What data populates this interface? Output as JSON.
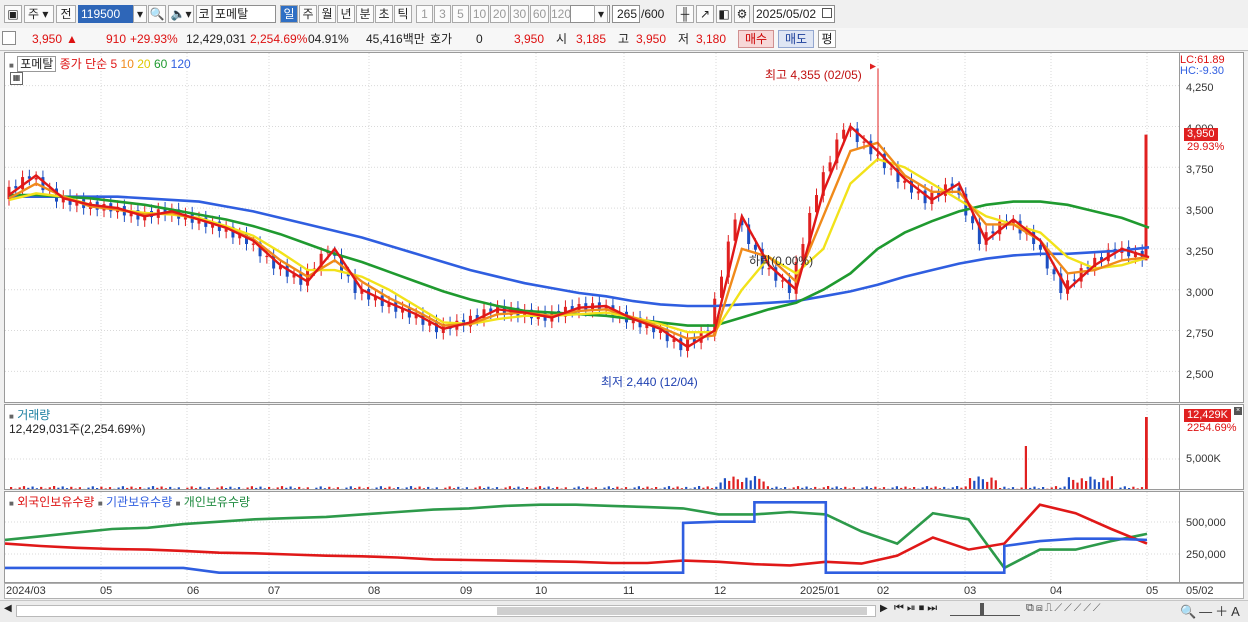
{
  "toolbar": {
    "market_label": "주",
    "prev_label": "전",
    "code_value": "119500",
    "market_tag": "코",
    "stock_name": "포메탈",
    "periods": [
      "일",
      "주",
      "월",
      "년",
      "분",
      "초",
      "틱"
    ],
    "active_period": "일",
    "intervals": [
      "1",
      "3",
      "5",
      "10",
      "20",
      "30",
      "60",
      "120"
    ],
    "count_value": "265",
    "count_total": "/600",
    "date_value": "2025/05/02"
  },
  "quote": {
    "price": "3,950",
    "change": "910",
    "change_pct": "+29.93%",
    "volume": "12,429,031",
    "volume_pct": "2,254.69%",
    "turnover_pct": "04.91%",
    "amount": "45,416백만",
    "hoga_label": "호가",
    "hoga_value": "0",
    "hoga_price": "3,950",
    "open_label": "시",
    "open_value": "3,185",
    "high_label": "고",
    "high_value": "3,950",
    "low_label": "저",
    "low_value": "3,180",
    "buy_label": "매수",
    "sell_label": "매도",
    "avg_label": "평"
  },
  "price_panel": {
    "name": "포메탈",
    "ma_title": "종가 단순",
    "ma_periods": [
      "5",
      "10",
      "20",
      "60",
      "120"
    ],
    "lc_label": "LC:61.89",
    "hc_label": "HC:-9.30",
    "high_annotation": "최고 4,355 (02/05)",
    "low_annotation": "최저 2,440 (12/04)",
    "mid_annotation": "하락(0.00%)",
    "current_badge": "3,950",
    "current_pct": "29.93%",
    "y_ticks": [
      "4,250",
      "4,000",
      "3,750",
      "3,500",
      "3,250",
      "3,000",
      "2,750",
      "2,500"
    ]
  },
  "volume_panel": {
    "title": "거래량",
    "value_text": "12,429,031주(2,254.69%)",
    "badge": "12,429K",
    "badge_pct": "2254.69%",
    "y_tick": "5,000K"
  },
  "holdings_panel": {
    "series_labels": [
      "외국인보유수량",
      "기관보유수량",
      "개인보유수량"
    ],
    "y_ticks": [
      "500,000",
      "250,000"
    ]
  },
  "x_axis": [
    "2024/03",
    "05",
    "06",
    "07",
    "08",
    "09",
    "10",
    "11",
    "12",
    "2025/01",
    "02",
    "03",
    "04",
    "05",
    "05/02"
  ],
  "colors": {
    "up": "#e02020",
    "down": "#1d4fc2",
    "ma5": "#e01818",
    "ma10": "#f08a1a",
    "ma20": "#f2e21a",
    "ma60": "#1f9a2f",
    "ma120": "#2f5ee0",
    "foreign": "#e01818",
    "institution": "#2f5ee0",
    "individual": "#2d9a4a"
  },
  "chart_data": {
    "type": "line",
    "title": "",
    "series": [
      {
        "name": "5",
        "values": [
          3580,
          3700,
          3560,
          3520,
          3500,
          3450,
          3480,
          3430,
          3380,
          3300,
          3150,
          3050,
          3250,
          3000,
          2920,
          2850,
          2760,
          2800,
          2880,
          2860,
          2830,
          2890,
          2900,
          2820,
          2760,
          2650,
          2750,
          3450,
          3150,
          3000,
          3600,
          4000,
          3850,
          3680,
          3550,
          3650,
          3300,
          3430,
          3300,
          3000,
          3150,
          3250,
          3200
        ]
      },
      {
        "name": "10",
        "values": [
          3560,
          3650,
          3570,
          3510,
          3490,
          3460,
          3470,
          3430,
          3380,
          3310,
          3180,
          3080,
          3180,
          3050,
          2950,
          2870,
          2780,
          2790,
          2850,
          2860,
          2840,
          2870,
          2880,
          2830,
          2770,
          2700,
          2720,
          3250,
          3200,
          3050,
          3450,
          3850,
          3900,
          3700,
          3600,
          3600,
          3400,
          3400,
          3300,
          3100,
          3120,
          3180,
          3200
        ]
      },
      {
        "name": "20",
        "values": [
          3550,
          3590,
          3570,
          3520,
          3490,
          3470,
          3460,
          3440,
          3390,
          3330,
          3230,
          3120,
          3120,
          3080,
          3000,
          2900,
          2800,
          2790,
          2820,
          2840,
          2840,
          2850,
          2860,
          2830,
          2790,
          2740,
          2740,
          3000,
          3200,
          3100,
          3250,
          3650,
          3800,
          3750,
          3650,
          3550,
          3450,
          3400,
          3350,
          3200,
          3130,
          3150,
          3200
        ]
      },
      {
        "name": "60",
        "values": [
          3580,
          3580,
          3570,
          3560,
          3540,
          3520,
          3490,
          3460,
          3430,
          3390,
          3340,
          3280,
          3220,
          3170,
          3110,
          3050,
          2990,
          2940,
          2900,
          2870,
          2860,
          2850,
          2840,
          2820,
          2800,
          2780,
          2780,
          2830,
          2880,
          2920,
          3000,
          3100,
          3250,
          3350,
          3420,
          3480,
          3520,
          3540,
          3540,
          3520,
          3480,
          3440,
          3380
        ]
      },
      {
        "name": "120",
        "values": [
          3570,
          3570,
          3570,
          3570,
          3570,
          3560,
          3550,
          3540,
          3510,
          3480,
          3440,
          3400,
          3360,
          3320,
          3270,
          3220,
          3170,
          3120,
          3080,
          3040,
          3010,
          2980,
          2960,
          2930,
          2910,
          2900,
          2900,
          2910,
          2920,
          2930,
          2960,
          2990,
          3030,
          3080,
          3120,
          3160,
          3190,
          3210,
          3220,
          3220,
          3230,
          3240,
          3260
        ]
      }
    ],
    "x": [
      "2024/03",
      "",
      "05",
      "",
      "06",
      "",
      "07",
      "",
      "08",
      "",
      "",
      "09",
      "",
      "10",
      "",
      "11",
      "",
      "",
      "12",
      "",
      "",
      "2025/01",
      "",
      "02",
      "",
      "03",
      "",
      "04",
      "",
      "05",
      "",
      "",
      "",
      "",
      "",
      "",
      "",
      "",
      "",
      "",
      "",
      "",
      "05/02"
    ],
    "ylim": [
      2300,
      4450
    ],
    "high": {
      "value": 4355,
      "date": "02/05"
    },
    "low": {
      "value": 2440,
      "date": "12/04"
    },
    "last_close": 3950,
    "holdings": {
      "foreign": [
        300000,
        280000,
        265000,
        255000,
        250000,
        240000,
        225000,
        220000,
        210000,
        200000,
        195000,
        185000,
        170000,
        165000,
        160000,
        155000,
        150000,
        140000,
        140000,
        160000,
        150000,
        130000,
        120000,
        150000,
        135000,
        200000,
        350000,
        250000,
        300000,
        620000,
        550000,
        420000,
        300000
      ],
      "institution": [
        100000,
        100000,
        100000,
        100000,
        100000,
        100000,
        60000,
        60000,
        60000,
        60000,
        60000,
        60000,
        60000,
        60000,
        60000,
        60000,
        60000,
        60000,
        60000,
        470000,
        480000,
        640000,
        640000,
        60000,
        60000,
        60000,
        60000,
        60000,
        280000,
        320000,
        340000,
        340000,
        330000
      ],
      "individual": [
        330000,
        360000,
        390000,
        420000,
        430000,
        460000,
        480000,
        500000,
        510000,
        520000,
        540000,
        560000,
        580000,
        590000,
        610000,
        620000,
        620000,
        610000,
        600000,
        590000,
        540000,
        540000,
        560000,
        540000,
        400000,
        300000,
        550000,
        500000,
        100000,
        250000,
        250000,
        320000,
        380000
      ]
    }
  }
}
